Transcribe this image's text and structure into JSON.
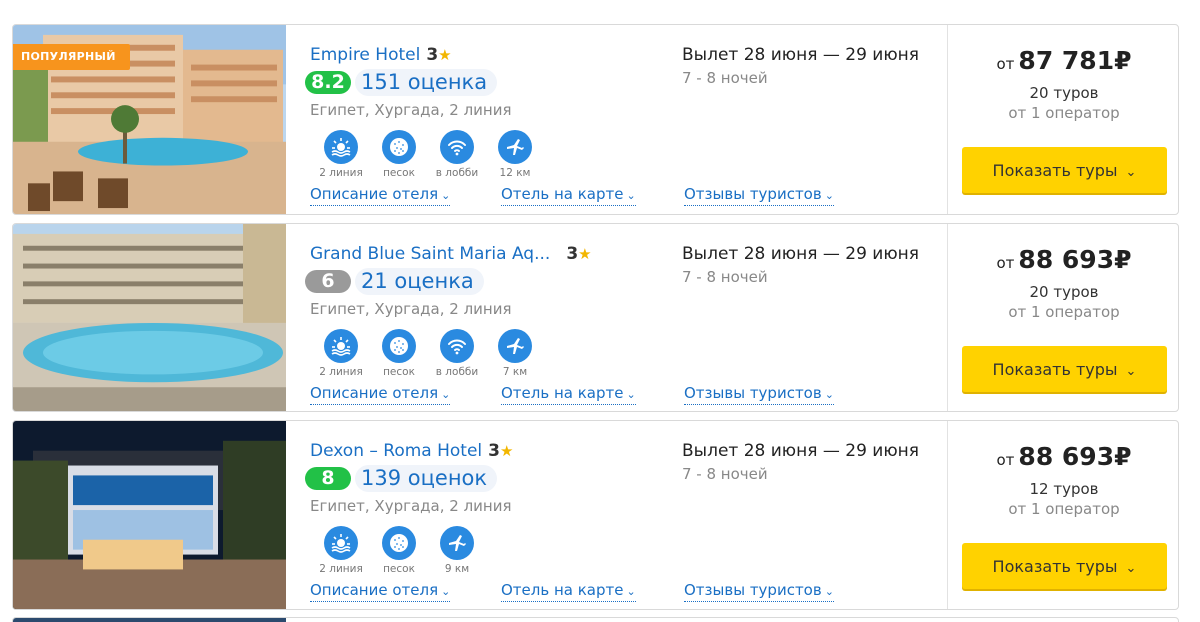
{
  "hotels": [
    {
      "name": "Empire Hotel",
      "stars": "3",
      "rating": "8.2",
      "rating_color": "#22c147",
      "reviews": "151 оценка",
      "location": "Египет, Хургада, 2 линия",
      "badge": "ПОПУЛЯРНЫЙ",
      "amenities": [
        {
          "icon": "beach-line-icon",
          "label": "2 линия"
        },
        {
          "icon": "sand-icon",
          "label": "песок"
        },
        {
          "icon": "wifi-icon",
          "label": "в лобби"
        },
        {
          "icon": "airport-icon",
          "label": "12 км"
        }
      ],
      "links": {
        "description": "Описание отеля",
        "map": "Отель на карте",
        "reviews": "Отзывы туристов"
      },
      "dates": "Вылет 28 июня — 29 июня",
      "nights": "7 - 8 ночей",
      "price_from": "от",
      "price": "87 781₽",
      "tours": "20 туров",
      "operators": "от 1 оператор",
      "button": "Показать туры"
    },
    {
      "name": "Grand Blue Saint Maria Aq...",
      "stars": "3",
      "rating": "6",
      "rating_color": "#9a9a9a",
      "reviews": "21 оценка",
      "location": "Египет, Хургада, 2 линия",
      "amenities": [
        {
          "icon": "beach-line-icon",
          "label": "2 линия"
        },
        {
          "icon": "sand-icon",
          "label": "песок"
        },
        {
          "icon": "wifi-icon",
          "label": "в лобби"
        },
        {
          "icon": "airport-icon",
          "label": "7 км"
        }
      ],
      "links": {
        "description": "Описание отеля",
        "map": "Отель на карте",
        "reviews": "Отзывы туристов"
      },
      "dates": "Вылет 28 июня — 29 июня",
      "nights": "7 - 8 ночей",
      "price_from": "от",
      "price": "88 693₽",
      "tours": "20 туров",
      "operators": "от 1 оператор",
      "button": "Показать туры"
    },
    {
      "name": "Dexon – Roma Hotel",
      "stars": "3",
      "rating": "8",
      "rating_color": "#22c147",
      "reviews": "139 оценок",
      "location": "Египет, Хургада, 2 линия",
      "amenities": [
        {
          "icon": "beach-line-icon",
          "label": "2 линия"
        },
        {
          "icon": "sand-icon",
          "label": "песок"
        },
        {
          "icon": "airport-icon",
          "label": "9 км"
        }
      ],
      "links": {
        "description": "Описание отеля",
        "map": "Отель на карте",
        "reviews": "Отзывы туристов"
      },
      "dates": "Вылет 28 июня — 29 июня",
      "nights": "7 - 8 ночей",
      "price_from": "от",
      "price": "88 693₽",
      "tours": "12 туров",
      "operators": "от 1 оператор",
      "button": "Показать туры"
    }
  ],
  "colors": {
    "accent": "#1a6fc4",
    "button": "#ffd200",
    "badge": "#f7941d",
    "amenity": "#2a8ae0"
  }
}
